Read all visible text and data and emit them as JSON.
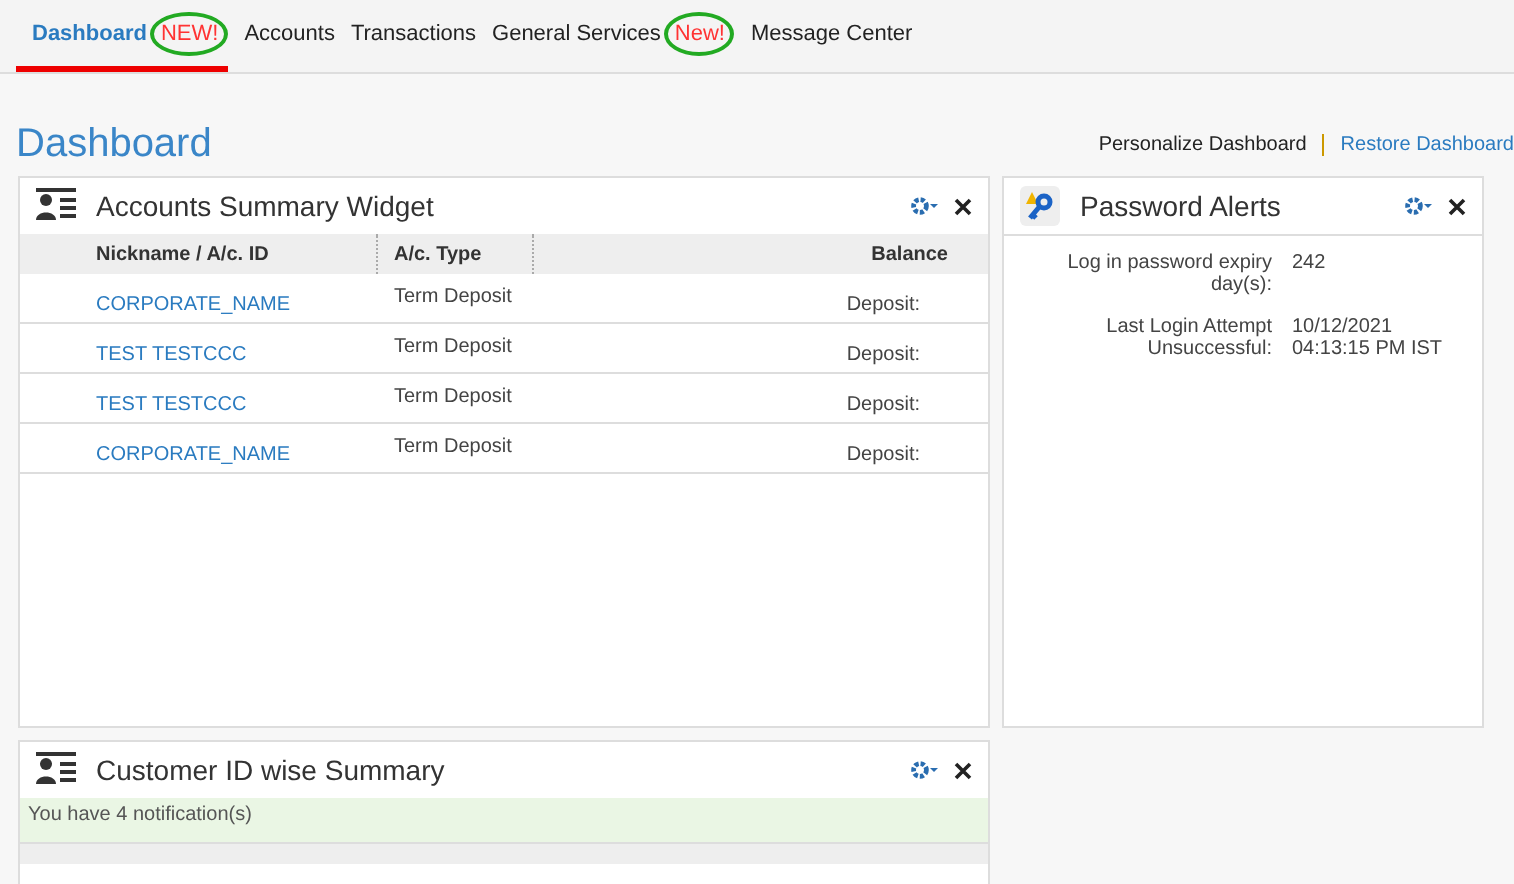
{
  "nav": [
    {
      "label": "Dashboard",
      "selected": true,
      "badge": "NEW!"
    },
    {
      "label": "Accounts",
      "selected": false
    },
    {
      "label": "Transactions",
      "selected": false
    },
    {
      "label": "General Services",
      "selected": false,
      "badge": "New!"
    },
    {
      "label": "Message Center",
      "selected": false
    }
  ],
  "page_title": "Dashboard",
  "links": [
    "Personalize Dashboard",
    "Restore Dashboard"
  ],
  "accounts_widget": {
    "title": "Accounts Summary Widget",
    "columns": [
      "Nickname / A/c. ID",
      "A/c. Type",
      "Balance"
    ],
    "rows": [
      {
        "nickname": "CORPORATE_NAME",
        "type": "Term Deposit",
        "balance": "Deposit:"
      },
      {
        "nickname": "TEST TESTCCC",
        "type": "Term Deposit",
        "balance": "Deposit:"
      },
      {
        "nickname": "TEST TESTCCC",
        "type": "Term Deposit",
        "balance": "Deposit:"
      },
      {
        "nickname": "CORPORATE_NAME",
        "type": "Term Deposit",
        "balance": "Deposit:"
      }
    ]
  },
  "password_widget": {
    "title": "Password Alerts",
    "fields": [
      {
        "label": "Log in password expiry day(s):",
        "value": "242"
      },
      {
        "label": "Last Login Attempt Unsuccessful:",
        "value": "10/12/2021 04:13:15 PM IST"
      }
    ]
  },
  "customer_widget": {
    "title": "Customer ID wise Summary",
    "notification": "You have 4 notification(s)"
  }
}
